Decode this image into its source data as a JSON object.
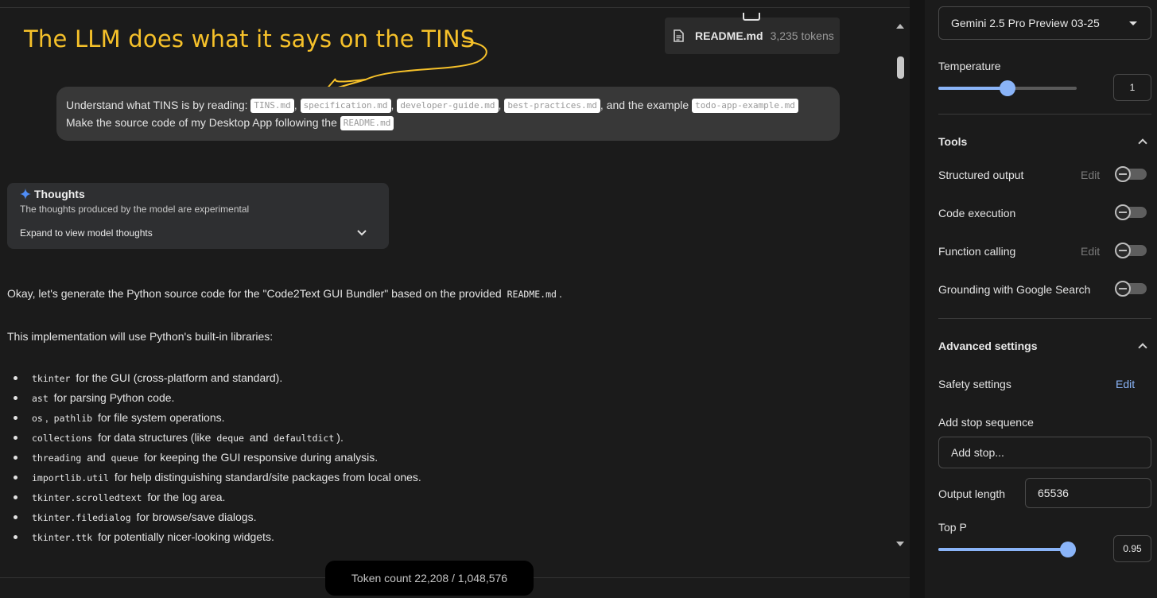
{
  "annotation": {
    "text": "The LLM does what it says on the TINS",
    "color": "#f6c12a"
  },
  "file_chip": {
    "name": "README.md",
    "tokens": "3,235 tokens",
    "icon": "document-icon"
  },
  "user_message": {
    "line1_prefix": "Understand what TINS is by reading:",
    "files": [
      "TINS.md",
      "specification.md",
      "developer-guide.md",
      "best-practices.md"
    ],
    "sep": ",",
    "and_example": ", and the example",
    "example_file": "todo-app-example.md",
    "line2_prefix": "Make the source code of my Desktop App following the",
    "line2_file": "README.md"
  },
  "thoughts": {
    "title": "Thoughts",
    "subtitle": "The thoughts produced by the model are experimental",
    "expand": "Expand to view model thoughts",
    "icon": "sparkle-icon",
    "icon_color": "#4f8df7"
  },
  "response": {
    "intro_prefix": "Okay, let's generate the Python source code for the \"Code2Text GUI Bundler\" based on the provided",
    "intro_code": "README.md",
    "intro_suffix": ".",
    "libs_intro": "This implementation will use Python's built-in libraries:",
    "bullets": [
      {
        "c1": "tkinter",
        "t1": "for the GUI (cross-platform and standard)."
      },
      {
        "c1": "ast",
        "t1": "for parsing Python code."
      },
      {
        "c1": "os",
        "m": ",",
        "c2": "pathlib",
        "t1": "for file system operations."
      },
      {
        "c1": "collections",
        "t1": "for data structures (like",
        "c2": "deque",
        "t2": "and",
        "c3": "defaultdict",
        "t3": ")."
      },
      {
        "c1": "threading",
        "t1": "and",
        "c2": "queue",
        "t2": "for keeping the GUI responsive during analysis."
      },
      {
        "c1": "importlib.util",
        "t1": "for help distinguishing standard/site packages from local ones."
      },
      {
        "c1": "tkinter.scrolledtext",
        "t1": "for the log area."
      },
      {
        "c1": "tkinter.filedialog",
        "t1": "for browse/save dialogs."
      },
      {
        "c1": "tkinter.ttk",
        "t1": "for potentially nicer-looking widgets."
      }
    ]
  },
  "token_count": "Token count 22,208 / 1,048,576",
  "panel": {
    "model": "Gemini 2.5 Pro Preview 03-25",
    "temperature_label": "Temperature",
    "temperature_value": "1",
    "temperature_fraction": 0.5,
    "tools_label": "Tools",
    "tools": [
      {
        "label": "Structured output",
        "edit": "Edit",
        "enabled": false
      },
      {
        "label": "Code execution",
        "enabled": false
      },
      {
        "label": "Function calling",
        "edit": "Edit",
        "enabled": false
      },
      {
        "label": "Grounding with Google Search",
        "enabled": false
      }
    ],
    "advanced_label": "Advanced settings",
    "safety_label": "Safety settings",
    "safety_edit": "Edit",
    "stop_label": "Add stop sequence",
    "stop_placeholder": "Add stop...",
    "output_label": "Output length",
    "output_value": "65536",
    "topp_label": "Top P",
    "topp_value": "0.95",
    "topp_fraction": 0.95,
    "accent": "#8ab4f8"
  }
}
